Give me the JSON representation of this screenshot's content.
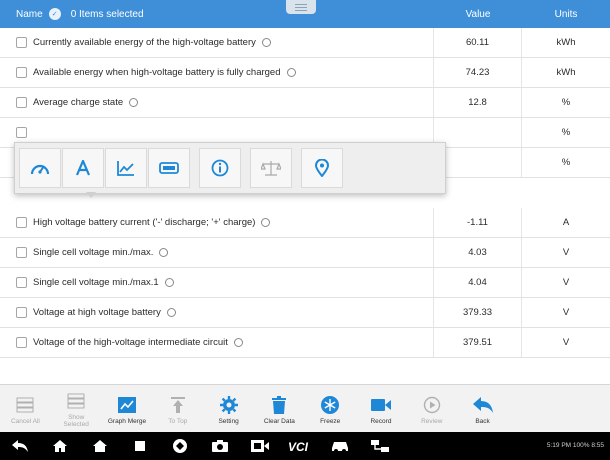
{
  "header": {
    "name_label": "Name",
    "items_selected": "0 Items selected",
    "value_label": "Value",
    "units_label": "Units",
    "accent_color": "#3f8fd8"
  },
  "rows": [
    {
      "name": "Currently available energy of the high-voltage battery",
      "value": "60.11",
      "unit": "kWh"
    },
    {
      "name": "Available energy when high-voltage battery is fully charged",
      "value": "74.23",
      "unit": "kWh"
    },
    {
      "name": "Average charge state",
      "value": "12.8",
      "unit": "%"
    },
    {
      "name": "",
      "value": "",
      "unit": "%"
    },
    {
      "name": "",
      "value": "",
      "unit": "%"
    },
    {
      "name": "High voltage battery current ('-' discharge; '+' charge)",
      "value": "-1.11",
      "unit": "A"
    },
    {
      "name": "Single cell voltage min./max.",
      "value": "4.03",
      "unit": "V"
    },
    {
      "name": "Single cell voltage min./max.1",
      "value": "4.04",
      "unit": "V"
    },
    {
      "name": "Voltage at high voltage battery",
      "value": "379.33",
      "unit": "V"
    },
    {
      "name": "Voltage of the high-voltage intermediate circuit",
      "value": "379.51",
      "unit": "V"
    }
  ],
  "popup": {
    "buttons": [
      "gauge-icon",
      "text-icon",
      "line-graph-icon",
      "digital-display-icon",
      "info-icon",
      "scale-icon",
      "location-pin-icon"
    ]
  },
  "function_bar": [
    {
      "label": "Cancel All",
      "icon": "cancel-all-icon",
      "enabled": false
    },
    {
      "label": "Show\nSelected",
      "icon": "show-selected-icon",
      "enabled": false
    },
    {
      "label": "Graph Merge",
      "icon": "graph-merge-icon",
      "enabled": true
    },
    {
      "label": "To Top",
      "icon": "to-top-icon",
      "enabled": false
    },
    {
      "label": "Setting",
      "icon": "setting-icon",
      "enabled": true
    },
    {
      "label": "Clear Data",
      "icon": "clear-data-icon",
      "enabled": true
    },
    {
      "label": "Freeze",
      "icon": "freeze-icon",
      "enabled": true
    },
    {
      "label": "Record",
      "icon": "record-icon",
      "enabled": true
    },
    {
      "label": "Review",
      "icon": "review-icon",
      "enabled": false
    },
    {
      "label": "Back",
      "icon": "back-icon",
      "enabled": true
    }
  ],
  "navbar": {
    "status_text": "5:19 PM 100% 8:55"
  }
}
